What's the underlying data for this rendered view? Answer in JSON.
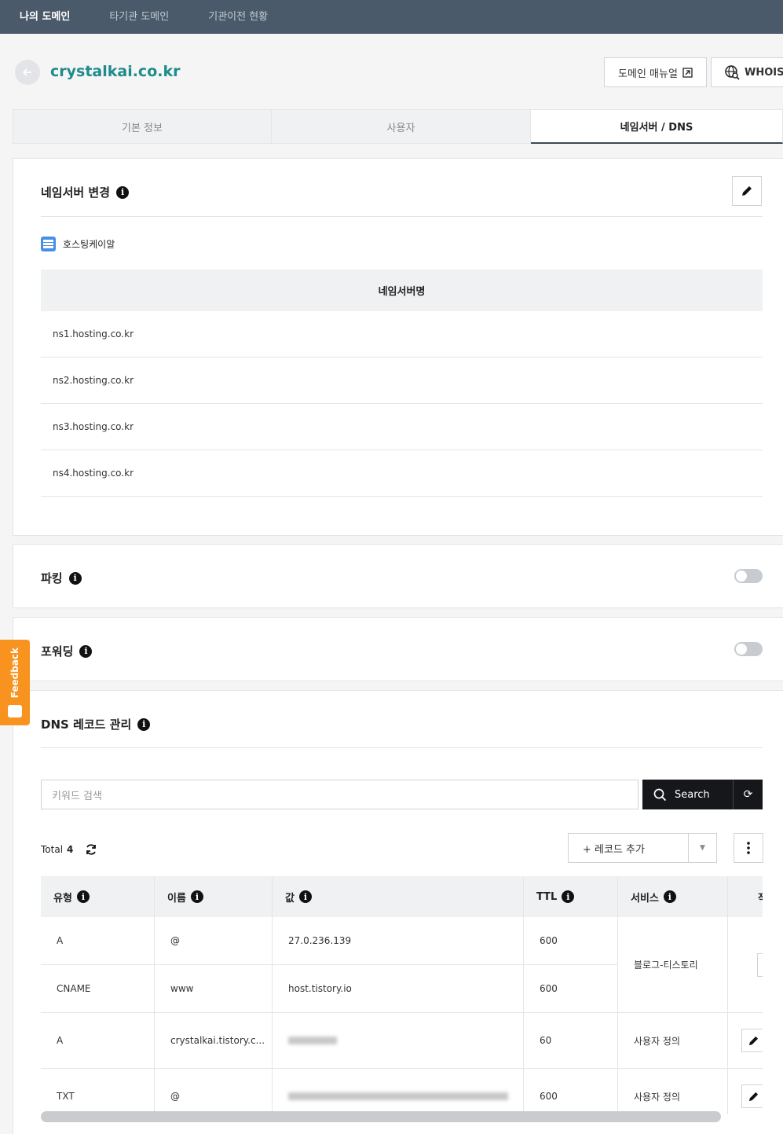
{
  "topnav": {
    "items": [
      "나의 도메인",
      "타기관 도메인",
      "기관이전 현황"
    ]
  },
  "header": {
    "domain": "crystalkai.co.kr",
    "manual_label": "도메인 매뉴얼",
    "whois_label": "WHOIS"
  },
  "tabs": [
    "기본 정보",
    "사용자",
    "네임서버 / DNS"
  ],
  "nameserver": {
    "title": "네임서버 변경",
    "provider": "호스팅케이알",
    "column_header": "네임서버명",
    "servers": [
      "ns1.hosting.co.kr",
      "ns2.hosting.co.kr",
      "ns3.hosting.co.kr",
      "ns4.hosting.co.kr"
    ]
  },
  "parking": {
    "title": "파킹",
    "enabled": false
  },
  "forwarding": {
    "title": "포워딩",
    "enabled": false
  },
  "feedback_label": "Feedback",
  "dns": {
    "title": "DNS 레코드 관리",
    "search_placeholder": "키워드 검색",
    "search_label": "Search",
    "total_label": "Total",
    "total_count": "4",
    "add_record_label": "+ 레코드 추가",
    "columns": [
      "유형",
      "이름",
      "값",
      "TTL",
      "서비스",
      "작"
    ],
    "rows": [
      {
        "type": "A",
        "name": "@",
        "value": "27.0.236.139",
        "ttl": "600",
        "service": "블로그-티스토리"
      },
      {
        "type": "CNAME",
        "name": "www",
        "value": "host.tistory.io",
        "ttl": "600",
        "service": "블로그-티스토리"
      },
      {
        "type": "A",
        "name": "crystalkai.tistory.c...",
        "value": "",
        "ttl": "60",
        "service": "사용자 정의"
      },
      {
        "type": "TXT",
        "name": "@",
        "value": "",
        "ttl": "600",
        "service": "사용자 정의"
      }
    ]
  },
  "colors": {
    "accent": "#1f8b8b",
    "nav_bg": "#4b5a6a",
    "feedback": "#f7931e"
  }
}
